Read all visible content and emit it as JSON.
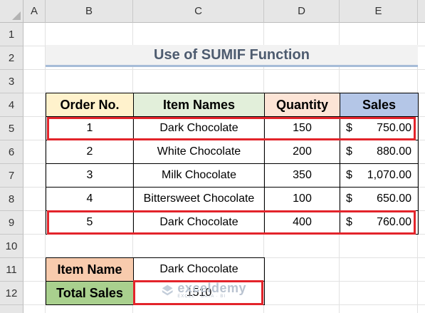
{
  "columns": [
    "A",
    "B",
    "C",
    "D",
    "E"
  ],
  "rows": [
    "1",
    "2",
    "3",
    "4",
    "5",
    "6",
    "7",
    "8",
    "9",
    "10",
    "11",
    "12"
  ],
  "title": "Use of SUMIF Function",
  "table": {
    "headers": [
      "Order No.",
      "Item Names",
      "Quantity",
      "Sales"
    ],
    "rows": [
      {
        "order": "1",
        "item": "Dark Chocolate",
        "qty": "150",
        "cur": "$",
        "sales": "750.00"
      },
      {
        "order": "2",
        "item": "White Chocolate",
        "qty": "200",
        "cur": "$",
        "sales": "880.00"
      },
      {
        "order": "3",
        "item": "Milk Chocolate",
        "qty": "350",
        "cur": "$",
        "sales": "1,070.00"
      },
      {
        "order": "4",
        "item": "Bittersweet Chocolate",
        "qty": "100",
        "cur": "$",
        "sales": "650.00"
      },
      {
        "order": "5",
        "item": "Dark Chocolate",
        "qty": "400",
        "cur": "$",
        "sales": "760.00"
      }
    ]
  },
  "summary": {
    "item_name_label": "Item Name",
    "item_name_value": "Dark Chocolate",
    "total_label": "Total Sales",
    "total_value": "1510"
  },
  "watermark": {
    "name": "exceldemy",
    "tagline": "EXCEL · DATA · BI"
  },
  "colors": {
    "order_header": "#fff2cc",
    "item_header": "#e2efda",
    "qty_header": "#fce4d6",
    "sales_header": "#b4c6e7",
    "label_item": "#f8cbad",
    "label_total": "#a9d08e",
    "highlight": "#e3242b"
  }
}
